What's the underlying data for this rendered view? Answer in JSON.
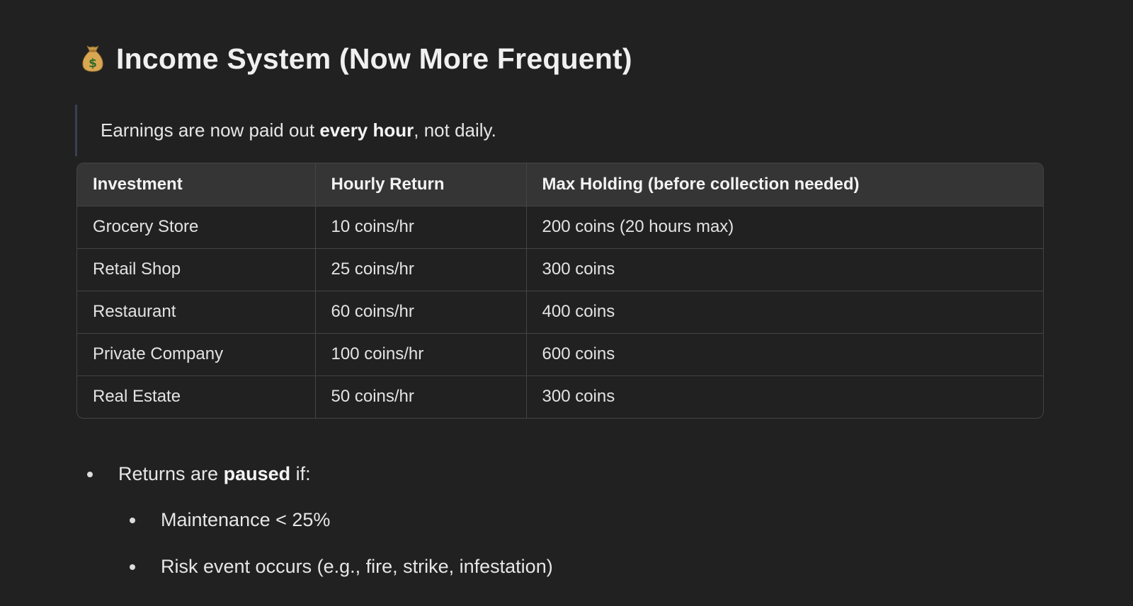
{
  "heading": {
    "emoji_icon": "money-bag-icon",
    "title": "Income System (Now More Frequent)"
  },
  "quote": {
    "before": "Earnings are now paid out ",
    "bold": "every hour",
    "after": ", not daily."
  },
  "table": {
    "headers": [
      "Investment",
      "Hourly Return",
      "Max Holding (before collection needed)"
    ],
    "rows": [
      [
        "Grocery Store",
        "10 coins/hr",
        "200 coins (20 hours max)"
      ],
      [
        "Retail Shop",
        "25 coins/hr",
        "300 coins"
      ],
      [
        "Restaurant",
        "60 coins/hr",
        "400 coins"
      ],
      [
        "Private Company",
        "100 coins/hr",
        "600 coins"
      ],
      [
        "Real Estate",
        "50 coins/hr",
        "300 coins"
      ]
    ]
  },
  "list": {
    "item1": {
      "before": "Returns are ",
      "bold": "paused",
      "after": " if:"
    },
    "sub_items": [
      "Maintenance < 25%",
      "Risk event occurs (e.g., fire, strike, infestation)"
    ]
  },
  "colors": {
    "background": "#212121",
    "table_header_bg": "#353535",
    "border": "#444444",
    "quote_bar": "#3a4052"
  }
}
